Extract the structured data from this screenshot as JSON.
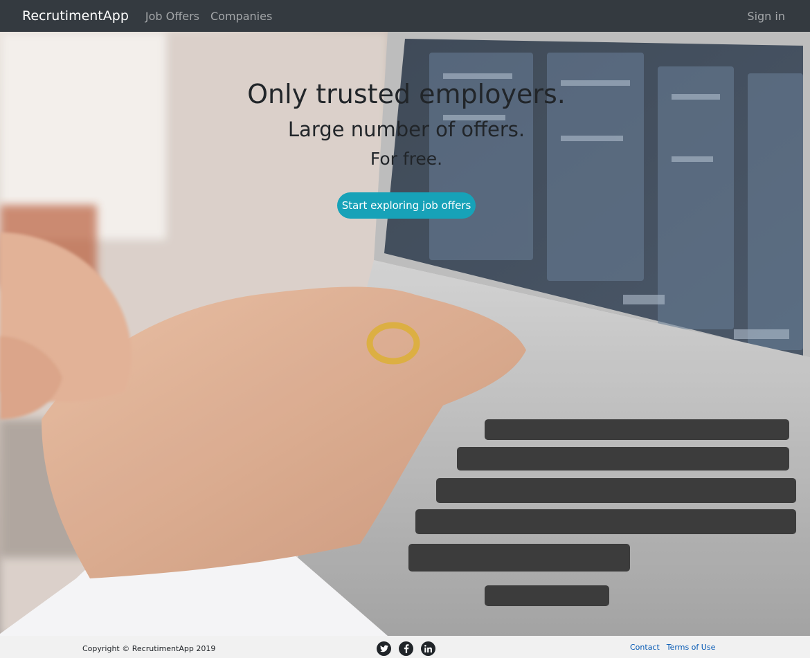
{
  "navbar": {
    "brand": "RecrutimentApp",
    "links": [
      "Job Offers",
      "Companies"
    ],
    "signin": "Sign in"
  },
  "hero": {
    "headline": "Only trusted employers.",
    "subheadline": "Large number of offers.",
    "tagline": "For free.",
    "cta": "Start exploring job offers"
  },
  "footer": {
    "copyright": "Copyright © RecrutimentApp 2019",
    "social": [
      "twitter-icon",
      "facebook-icon",
      "linkedin-icon"
    ],
    "links": [
      "Contact",
      "Terms of Use"
    ]
  },
  "colors": {
    "navbar": "#343a40",
    "accent": "#17a2b8",
    "link": "#0056b3"
  }
}
